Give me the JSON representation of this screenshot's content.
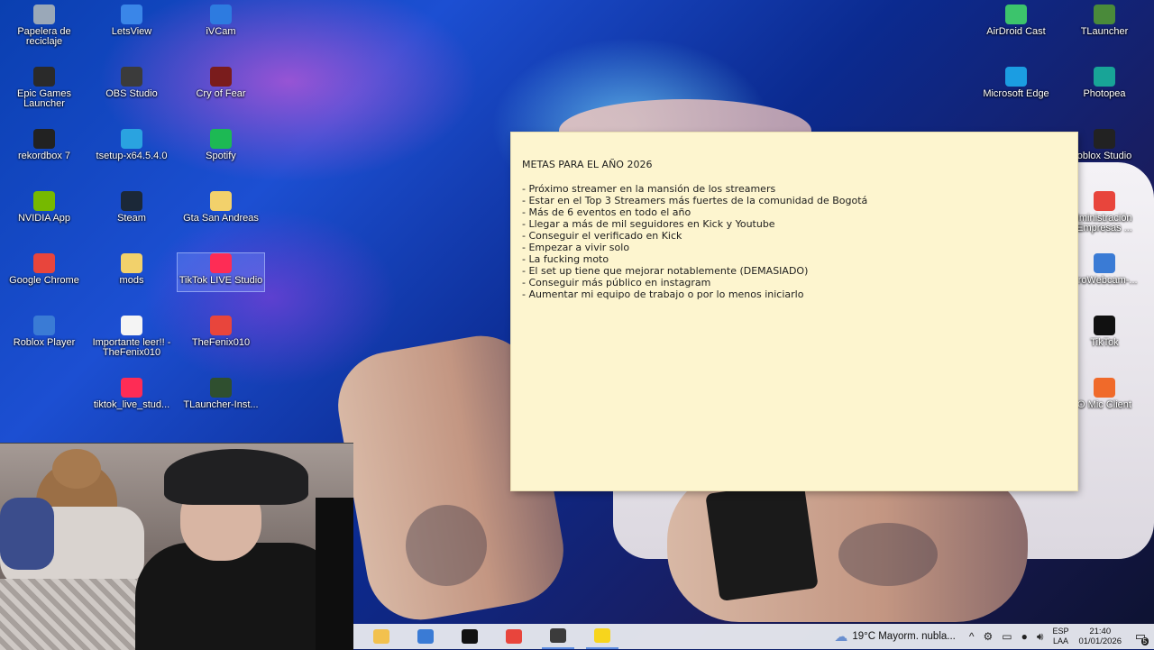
{
  "desktop": {
    "icons": [
      {
        "label": "Papelera de reciclaje",
        "icon": "recycle-bin-icon",
        "color": "#9aa8b8"
      },
      {
        "label": "LetsView",
        "icon": "letsview-icon",
        "color": "#3a86e8"
      },
      {
        "label": "iVCam",
        "icon": "ivcam-icon",
        "color": "#2d7be0"
      },
      {
        "label": "Epic Games Launcher",
        "icon": "epic-games-icon",
        "color": "#2a2a2a"
      },
      {
        "label": "OBS Studio",
        "icon": "obs-icon",
        "color": "#3b3b3b"
      },
      {
        "label": "Cry of Fear",
        "icon": "cry-of-fear-icon",
        "color": "#7a1c1c"
      },
      {
        "label": "rekordbox 7",
        "icon": "rekordbox-icon",
        "color": "#222222"
      },
      {
        "label": "tsetup-x64.5.4.0",
        "icon": "telegram-icon",
        "color": "#2aa3e0"
      },
      {
        "label": "Spotify",
        "icon": "spotify-icon",
        "color": "#1db954"
      },
      {
        "label": "NVIDIA App",
        "icon": "nvidia-icon",
        "color": "#76b900"
      },
      {
        "label": "Steam",
        "icon": "steam-icon",
        "color": "#1b2838"
      },
      {
        "label": "Gta San Andreas",
        "icon": "folder-icon",
        "color": "#f2d16b"
      },
      {
        "label": "Google Chrome",
        "icon": "chrome-icon",
        "color": "#e8453c"
      },
      {
        "label": "mods",
        "icon": "folder-icon",
        "color": "#f2d16b"
      },
      {
        "label": "TikTok LIVE Studio",
        "icon": "tiktok-live-icon",
        "color": "#fe2c55"
      },
      {
        "label": "Roblox Player",
        "icon": "roblox-icon",
        "color": "#3a7bd5"
      },
      {
        "label": "Importante leer!! - TheFenix010",
        "icon": "text-file-icon",
        "color": "#f4f4f4"
      },
      {
        "label": "TheFenix010",
        "icon": "chrome-shortcut-icon",
        "color": "#e8453c"
      },
      {
        "label": "tiktok_live_stud...",
        "icon": "tiktok-installer-icon",
        "color": "#fe2c55"
      },
      {
        "label": "TLauncher-Inst...",
        "icon": "tlauncher-installer-icon",
        "color": "#2f4f2f"
      }
    ],
    "right_icons": [
      {
        "label": "AirDroid Cast",
        "icon": "airdroid-icon",
        "color": "#3cc46c"
      },
      {
        "label": "TLauncher",
        "icon": "tlauncher-icon",
        "color": "#4a8a3a"
      },
      {
        "label": "Microsoft Edge",
        "icon": "edge-icon",
        "color": "#1b9de2"
      },
      {
        "label": "Photopea",
        "icon": "photopea-icon",
        "color": "#18a497"
      },
      {
        "label": "oblox Studio",
        "icon": "roblox-studio-icon",
        "color": "#222222"
      },
      {
        "label": "lministración Empresas ...",
        "icon": "chrome-shortcut-icon",
        "color": "#e8453c"
      },
      {
        "label": "ProWebcam-...",
        "icon": "prowebcam-icon",
        "color": "#3a7bd5"
      },
      {
        "label": "TikTok",
        "icon": "tiktok-icon",
        "color": "#111111"
      },
      {
        "label": "O Mic Client",
        "icon": "mic-client-icon",
        "color": "#f06a2a"
      }
    ]
  },
  "sticky_note": {
    "title": "METAS PARA EL AÑO 2026",
    "goals": [
      "- Próximo streamer en la mansión de los streamers",
      "- Estar en el Top 3 Streamers más fuertes de la comunidad de Bogotá",
      "- Más de 6 eventos en todo el año",
      "- Llegar a más de mil seguidores en Kick y Youtube",
      "- Conseguir el verificado en Kick",
      "- Empezar a vivir solo",
      "- La fucking moto",
      "- El set up tiene que mejorar notablemente (DEMASIADO)",
      "- Conseguir más público en instagram",
      "- Aumentar mi equipo de trabajo o por lo menos iniciarlo"
    ],
    "background": "#fdf5cf"
  },
  "taskbar": {
    "apps": [
      {
        "icon": "file-explorer-icon",
        "color": "#f2c14e"
      },
      {
        "icon": "calendar-app-icon",
        "color": "#3a7bd5"
      },
      {
        "icon": "capcut-icon",
        "color": "#111111"
      },
      {
        "icon": "chrome-icon",
        "color": "#e8453c"
      },
      {
        "icon": "obs-icon",
        "color": "#3b3b3b"
      },
      {
        "icon": "sticky-notes-icon",
        "color": "#f7d51d"
      }
    ],
    "weather": "19°C  Mayorm. nubla...",
    "language": {
      "line1": "ESP",
      "line2": "LAA"
    },
    "time": "21:40",
    "date": "01/01/2026",
    "notification_count": "5"
  }
}
